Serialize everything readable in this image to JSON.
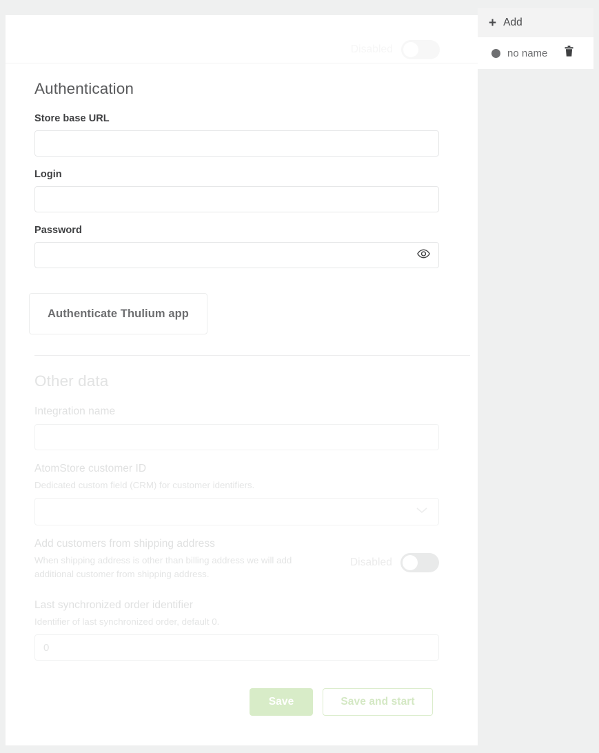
{
  "master_toggle": {
    "label": "Disabled",
    "state": "off"
  },
  "auth_section": {
    "title": "Authentication",
    "fields": [
      {
        "label": "Store base URL",
        "value": "",
        "placeholder": ""
      },
      {
        "label": "Login",
        "value": "",
        "placeholder": ""
      },
      {
        "label": "Password",
        "value": "",
        "placeholder": "",
        "icon": "eye-icon"
      }
    ],
    "authenticate_button": "Authenticate Thulium app"
  },
  "other_section": {
    "title": "Other data",
    "integration_name": {
      "label": "Integration name",
      "value": ""
    },
    "customer_id": {
      "label": "AtomStore customer ID",
      "hint": "Dedicated custom field (CRM) for customer identifiers.",
      "selected": "",
      "icon": "chevron-down-icon"
    },
    "shipping_address": {
      "label": "Add customers from shipping address",
      "hint": "When shipping address is other than billing address we will add additional customer from shipping address.",
      "toggle_label": "Disabled",
      "toggle_state": "off"
    },
    "last_order": {
      "label": "Last synchronized order identifier",
      "hint": "Identifier of last synchronized order, default 0.",
      "value": "0"
    }
  },
  "footer": {
    "save_label": "Save",
    "save_and_start_label": "Save and start"
  },
  "sidebar": {
    "add_label": "Add",
    "add_icon": "plus-icon",
    "items": [
      {
        "name": "no name",
        "status_icon": "status-dot-icon",
        "delete_icon": "trash-icon"
      }
    ]
  },
  "colors": {
    "page_bg": "#eff0f0",
    "card_bg": "#ffffff",
    "save_green": "#d8ecc8",
    "save_outline_green": "#dcedcd",
    "text_dark": "#3f4042",
    "text_muted": "#6d6e70",
    "disabled_text": "#e2e3e3"
  }
}
